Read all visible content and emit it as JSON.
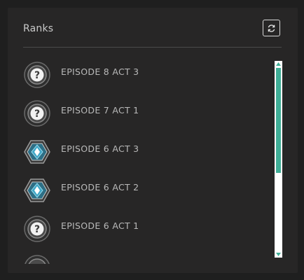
{
  "header": {
    "title": "Ranks",
    "refresh_icon": "refresh-icon"
  },
  "ranks": [
    {
      "label": "EPISODE 8 ACT 3",
      "icon": "unrated-question-icon"
    },
    {
      "label": "EPISODE 7 ACT 1",
      "icon": "unrated-question-icon"
    },
    {
      "label": "EPISODE 6 ACT 3",
      "icon": "diamond-rank-icon"
    },
    {
      "label": "EPISODE 6 ACT 2",
      "icon": "diamond-rank-icon"
    },
    {
      "label": "EPISODE 6 ACT 1",
      "icon": "unrated-question-icon"
    }
  ],
  "colors": {
    "accent": "#3fae97",
    "background": "#1f1f1f",
    "panel": "#272626"
  }
}
